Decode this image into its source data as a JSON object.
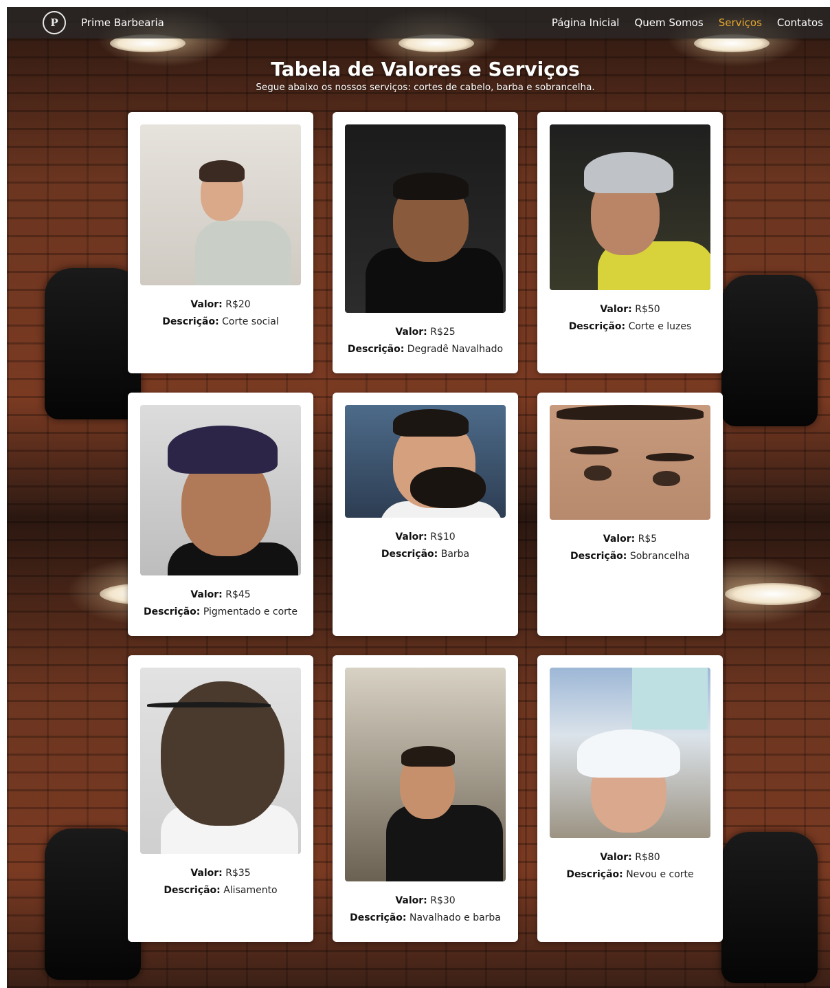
{
  "nav": {
    "logo_icon": "barber-shield-icon",
    "brand": "Prime Barbearia",
    "links": [
      {
        "label": "Página Inicial",
        "active": false
      },
      {
        "label": "Quem Somos",
        "active": false
      },
      {
        "label": "Serviços",
        "active": true
      },
      {
        "label": "Contatos",
        "active": false
      }
    ]
  },
  "header": {
    "title": "Tabela de Valores e Serviços",
    "subtitle": "Segue abaixo os nossos serviços: cortes de cabelo, barba e sobrancelha."
  },
  "labels": {
    "price": "Valor:",
    "description": "Descrição:"
  },
  "services": [
    {
      "price": "R$20",
      "description": "Corte social"
    },
    {
      "price": "R$25",
      "description": "Degradê Navalhado"
    },
    {
      "price": "R$50",
      "description": "Corte e luzes"
    },
    {
      "price": "R$45",
      "description": "Pigmentado e corte"
    },
    {
      "price": "R$10",
      "description": "Barba"
    },
    {
      "price": "R$5",
      "description": "Sobrancelha"
    },
    {
      "price": "R$35",
      "description": "Alisamento"
    },
    {
      "price": "R$30",
      "description": "Navalhado e barba"
    },
    {
      "price": "R$80",
      "description": "Nevou e corte"
    }
  ],
  "colors": {
    "accent": "#e8a92e",
    "navbar": "#282828",
    "card": "#ffffff"
  }
}
